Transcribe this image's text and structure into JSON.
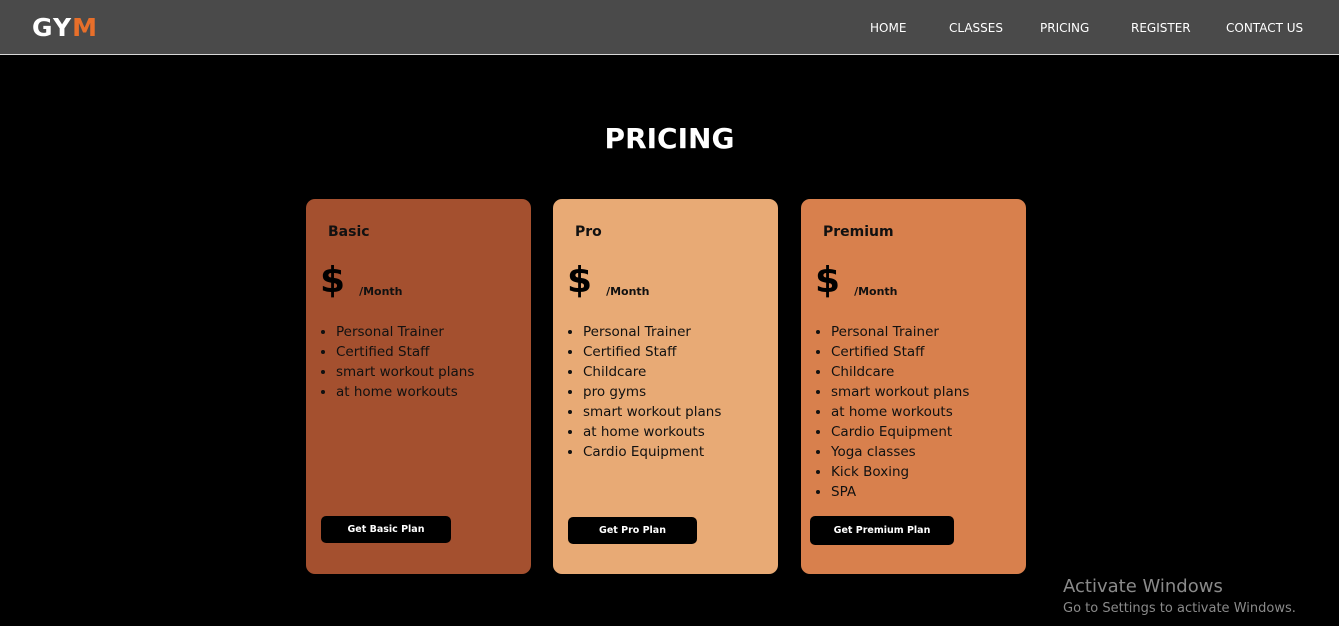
{
  "header": {
    "logo_part1": "GY",
    "logo_part2": "M",
    "nav": [
      "HOME",
      "CLASSES",
      "PRICING",
      "REGISTER",
      "CONTACT US"
    ]
  },
  "main": {
    "title": "PRICING",
    "plans": [
      {
        "name": "Basic",
        "currency": "$",
        "period": "/Month",
        "features": [
          "Personal Trainer",
          "Certified Staff",
          "smart workout plans",
          "at home workouts"
        ],
        "button": "Get Basic Plan"
      },
      {
        "name": "Pro",
        "currency": "$",
        "period": "/Month",
        "features": [
          "Personal Trainer",
          "Certified Staff",
          "Childcare",
          "pro gyms",
          "smart workout plans",
          "at home workouts",
          "Cardio Equipment"
        ],
        "button": "Get Pro Plan"
      },
      {
        "name": "Premium",
        "currency": "$",
        "period": "/Month",
        "features": [
          "Personal Trainer",
          "Certified Staff",
          "Childcare",
          "smart workout plans",
          "at home workouts",
          "Cardio Equipment",
          "Yoga classes",
          "Kick Boxing",
          "SPA"
        ],
        "button": "Get Premium Plan"
      }
    ]
  },
  "watermark": {
    "title": "Activate Windows",
    "subtitle": "Go to Settings to activate Windows."
  },
  "colors": {
    "navbar": "#4a4a4a",
    "logo_accent": "#e86f2a",
    "basic_card": "#a4502f",
    "pro_card": "#e8aa75",
    "premium_card": "#d8804d"
  }
}
